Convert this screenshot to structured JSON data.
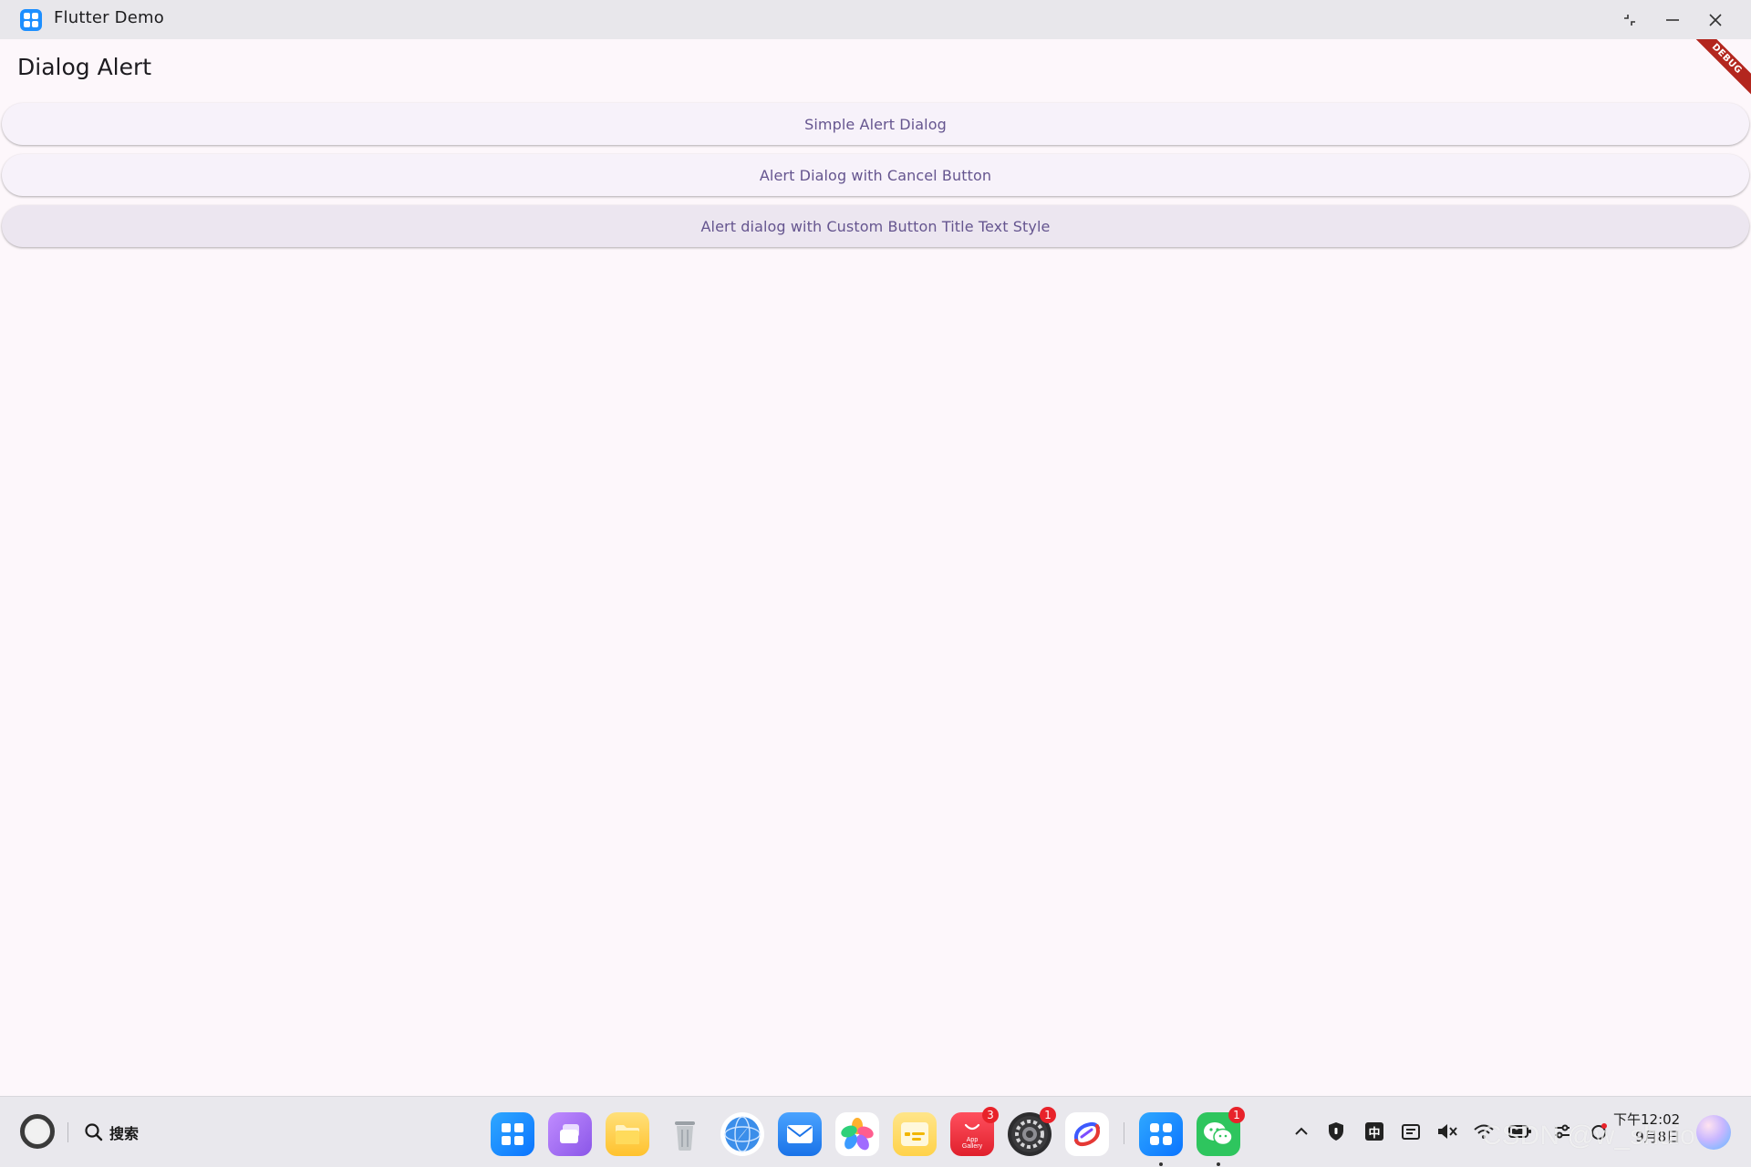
{
  "window": {
    "title": "Flutter Demo",
    "controls": [
      "restore-icon",
      "minimize-icon",
      "close-icon"
    ]
  },
  "app": {
    "page_title": "Dialog Alert",
    "debug_banner": "DEBUG",
    "buttons": [
      {
        "label": "Simple Alert Dialog"
      },
      {
        "label": "Alert Dialog with Cancel Button"
      },
      {
        "label": "Alert dialog with Custom Button Title Text Style"
      }
    ],
    "colors": {
      "background": "#fdf7fb",
      "button_bg": "#f7f2fa",
      "button_text": "#65558f",
      "debug_banner": "#b3261e"
    }
  },
  "taskbar": {
    "search_label": "搜索",
    "dock": [
      {
        "name": "launcher-icon"
      },
      {
        "name": "multitask-icon"
      },
      {
        "name": "files-icon"
      },
      {
        "name": "trash-icon"
      },
      {
        "name": "browser-icon"
      },
      {
        "name": "mail-icon"
      },
      {
        "name": "gallery-icon"
      },
      {
        "name": "notes-icon"
      },
      {
        "name": "appgallery-icon",
        "label": "App Gallery",
        "badge": "3"
      },
      {
        "name": "settings-icon",
        "badge": "1"
      },
      {
        "name": "devtool-icon"
      },
      {
        "name": "flutter-demo-icon",
        "running": true
      },
      {
        "name": "wechat-icon",
        "badge": "1",
        "running": true
      }
    ],
    "tray": [
      "chevron-up-icon",
      "shield-icon",
      "input-method-icon",
      "clipboard-icon",
      "mute-icon",
      "wifi-icon",
      "battery-icon",
      "controls-icon",
      "notification-icon"
    ],
    "input_method": "中",
    "clock": {
      "time": "下午12:02",
      "date": "9月8日"
    },
    "watermark": "CSDN @w_shuio"
  }
}
